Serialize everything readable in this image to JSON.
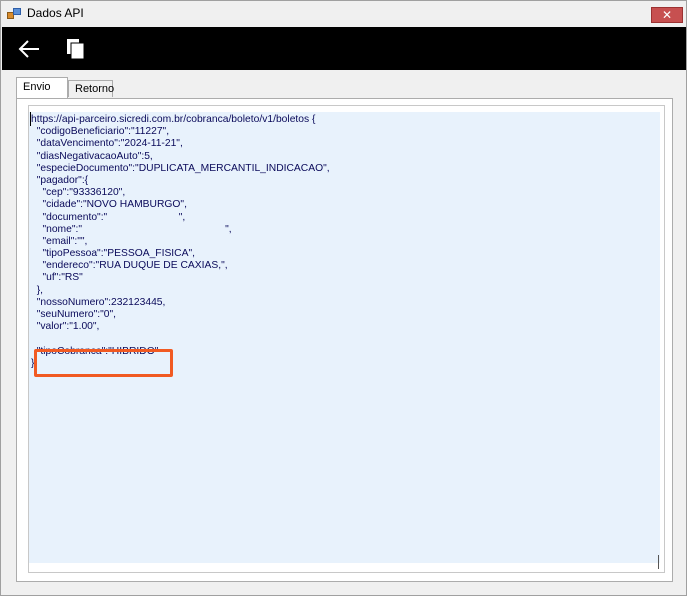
{
  "window": {
    "title": "Dados API",
    "close_symbol": "✕"
  },
  "toolbar": {
    "back_icon": "arrow-left-icon",
    "copy_icon": "copy-icon"
  },
  "tabs": [
    {
      "label": "Envio",
      "active": true
    },
    {
      "label": "Retorno",
      "active": false
    }
  ],
  "code": {
    "lines": [
      "https://api-parceiro.sicredi.com.br/cobranca/boleto/v1/boletos {",
      "  \"codigoBeneficiario\":\"11227\",",
      "  \"dataVencimento\":\"2024-11-21\",",
      "  \"diasNegativacaoAuto\":5,",
      "  \"especieDocumento\":\"DUPLICATA_MERCANTIL_INDICACAO\",",
      "  \"pagador\":{",
      "    \"cep\":\"93336120\",",
      "    \"cidade\":\"NOVO HAMBURGO\",",
      "    \"documento\":\"                         \",",
      "    \"nome\":\"                                                  \",",
      "    \"email\":\"\",",
      "    \"tipoPessoa\":\"PESSOA_FISICA\",",
      "    \"endereco\":\"RUA DUQUE DE CAXIAS,\",",
      "    \"uf\":\"RS\"",
      "  },",
      "  \"nossoNumero\":232123445,",
      "  \"seuNumero\":\"0\",",
      "  \"valor\":\"1.00\",",
      "",
      "  \"tipoCobranca\":\"HIBRIDO\"",
      "}"
    ]
  },
  "colors": {
    "accent_highlight": "#f15a22",
    "editor_bg": "#e8f2fc",
    "toolbar_bg": "#000000"
  }
}
